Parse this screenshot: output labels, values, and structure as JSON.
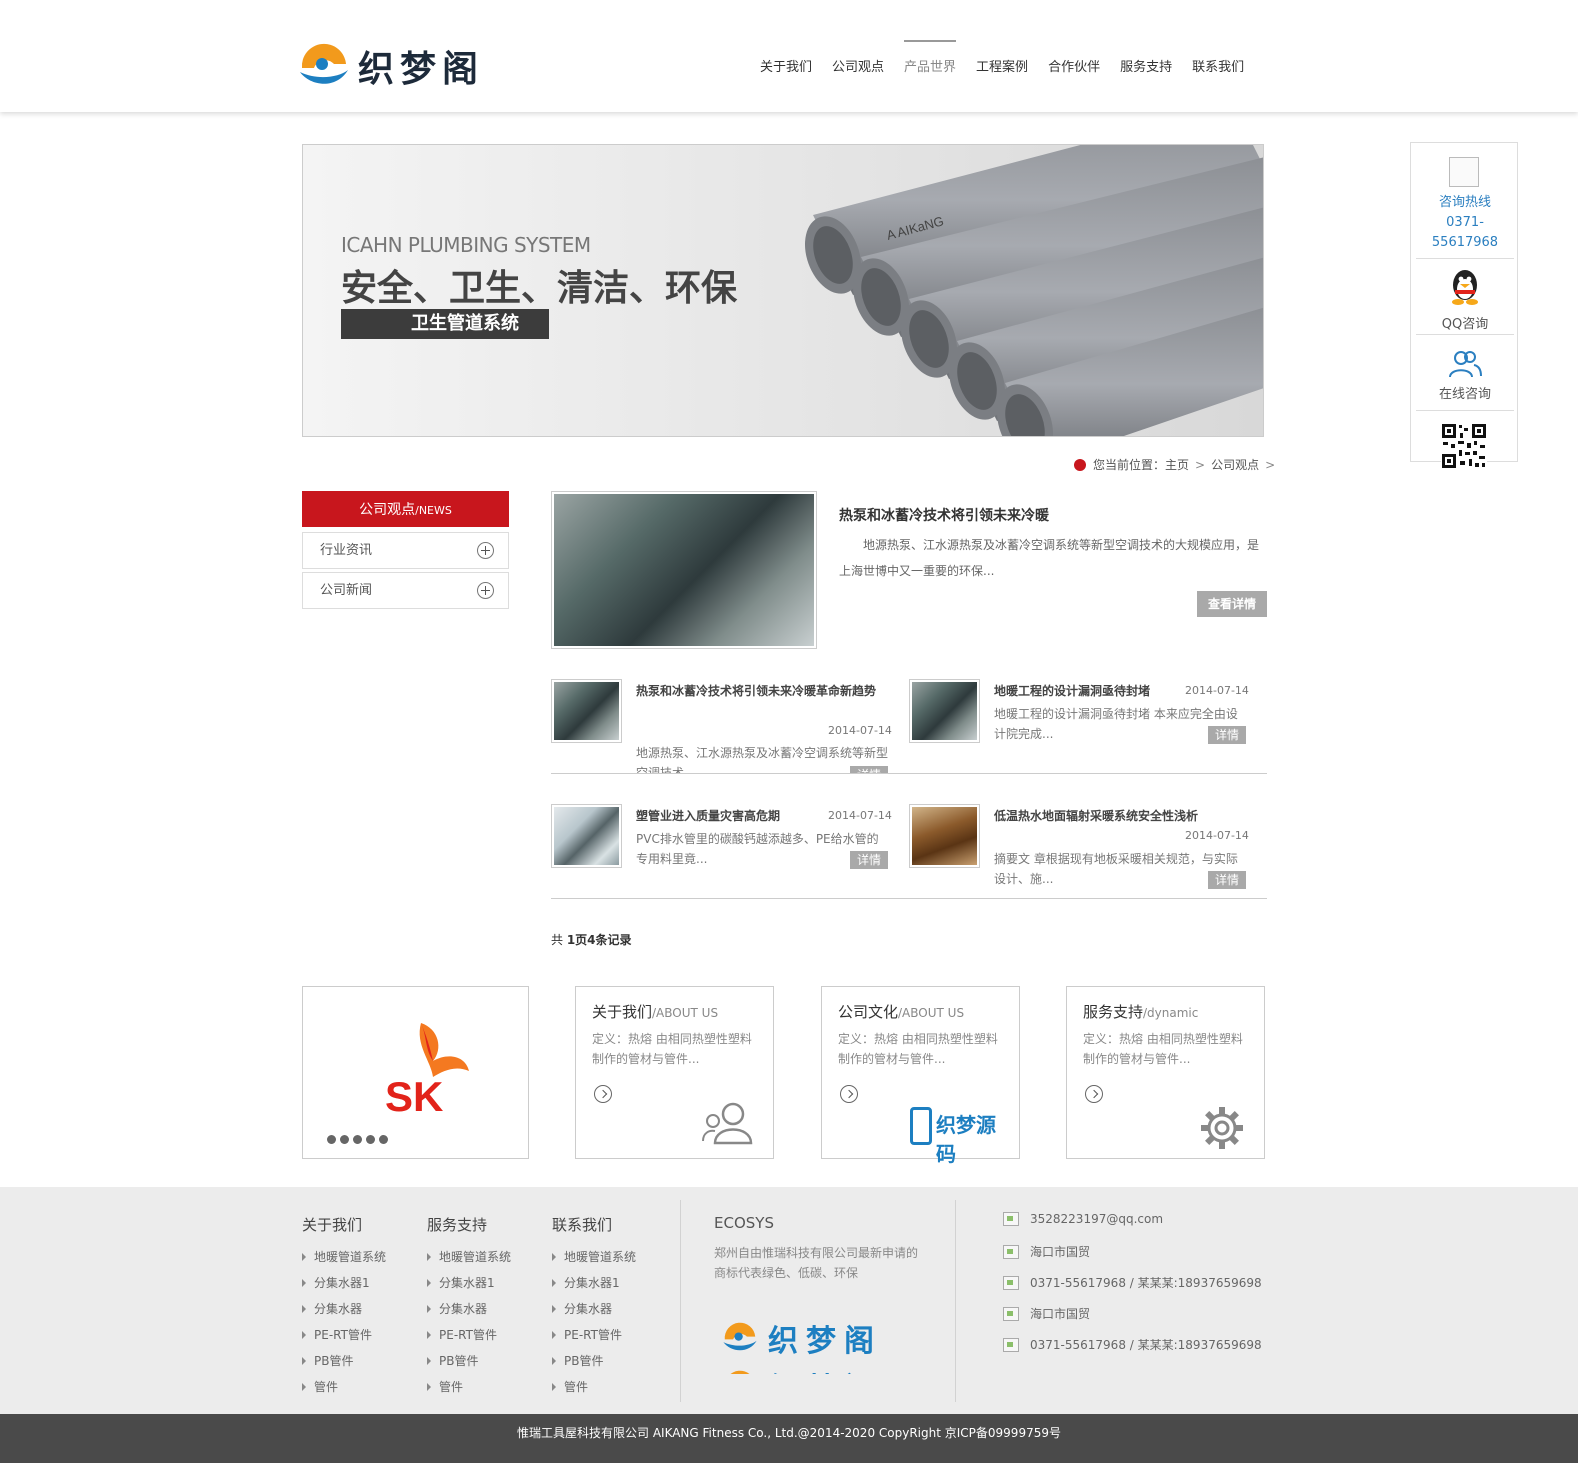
{
  "header": {
    "logo_text": "织梦阁",
    "nav": [
      "关于我们",
      "公司观点",
      "产品世界",
      "工程案例",
      "合作伙伴",
      "服务支持",
      "联系我们"
    ]
  },
  "banner": {
    "en": "ICAHN PLUMBING SYSTEM",
    "cn": "安全、卫生、清洁、环保",
    "tag": "卫生管道系统",
    "pipe_text": "A AIKaNG"
  },
  "sidebar_float": {
    "hotline_label": "咨询热线",
    "hotline_1": "0371-",
    "hotline_2": "55617968",
    "qq_label": "QQ咨询",
    "online_label": "在线咨询"
  },
  "breadcrumb": {
    "prefix": "您当前位置：",
    "home": "主页",
    "current": "公司观点"
  },
  "category": {
    "head": "公司观点",
    "head_en": "/NEWS",
    "items": [
      "行业资讯",
      "公司新闻"
    ]
  },
  "featured": {
    "title": "热泵和冰蓄冷技术将引领未来冷暖",
    "desc": "地源热泵、江水源热泵及冰蓄冷空调系统等新型空调技术的大规模应用，是上海世博中又一重要的环保...",
    "button": "查看详情"
  },
  "articles": [
    {
      "title": "热泵和冰蓄冷技术将引领未来冷暖革命新趋势",
      "date": "2014-07-14",
      "desc": "地源热泵、江水源热泵及冰蓄冷空调系统等新型空调技术...",
      "button": "详情"
    },
    {
      "title": "地暖工程的设计漏洞亟待封堵",
      "date": "2014-07-14",
      "desc": "地暖工程的设计漏洞亟待封堵 本来应完全由设计院完成...",
      "button": "详情"
    },
    {
      "title": "塑管业进入质量灾害高危期",
      "date": "2014-07-14",
      "desc": "PVC排水管里的碳酸钙越添越多、PE给水管的专用料里竟...",
      "button": "详情"
    },
    {
      "title": "低温热水地面辐射采暖系统安全性浅析",
      "date": "2014-07-14",
      "desc": "摘要文 章根据现有地板采暖相关规范，与实际设计、施...",
      "button": "详情"
    }
  ],
  "pager": {
    "text_a": "共 ",
    "text_b": "1页4条记录"
  },
  "cards": [
    {
      "title": "关于我们",
      "title_en": "/ABOUT US",
      "desc": "定义：热熔 由相同热塑性塑料制作的管材与管件..."
    },
    {
      "title": "公司文化",
      "title_en": "/ABOUT US",
      "desc": "定义：热熔 由相同热塑性塑料制作的管材与管件..."
    },
    {
      "title": "服务支持",
      "title_en": "/dynamic",
      "desc": "定义：热熔 由相同热塑性塑料制作的管材与管件..."
    }
  ],
  "sk_logo": "SK",
  "dedecms_logo": "织梦源码",
  "footer": {
    "columns": [
      {
        "title": "关于我们",
        "links": [
          "地暖管道系统",
          "分集水器1",
          "分集水器",
          "PE-RT管件",
          "PB管件",
          "管件"
        ]
      },
      {
        "title": "服务支持",
        "links": [
          "地暖管道系统",
          "分集水器1",
          "分集水器",
          "PE-RT管件",
          "PB管件",
          "管件"
        ]
      },
      {
        "title": "联系我们",
        "links": [
          "地暖管道系统",
          "分集水器1",
          "分集水器",
          "PE-RT管件",
          "PB管件",
          "管件"
        ]
      }
    ],
    "ecosys_title": "ECOSYS",
    "ecosys_desc": "郑州自由惟瑞科技有限公司最新申请的商标代表绿色、低碳、环保",
    "logo_text": "织梦阁",
    "contacts": [
      "3528223197@qq.com",
      "海口市国贸",
      "0371-55617968 / 某某某:18937659698",
      "海口市国贸",
      "0371-55617968 / 某某某:18937659698"
    ]
  },
  "copyright": "惟瑞工具屋科技有限公司 AIKANG Fitness Co., Ltd.@2014-2020 CopyRight 京ICP备09999759号"
}
